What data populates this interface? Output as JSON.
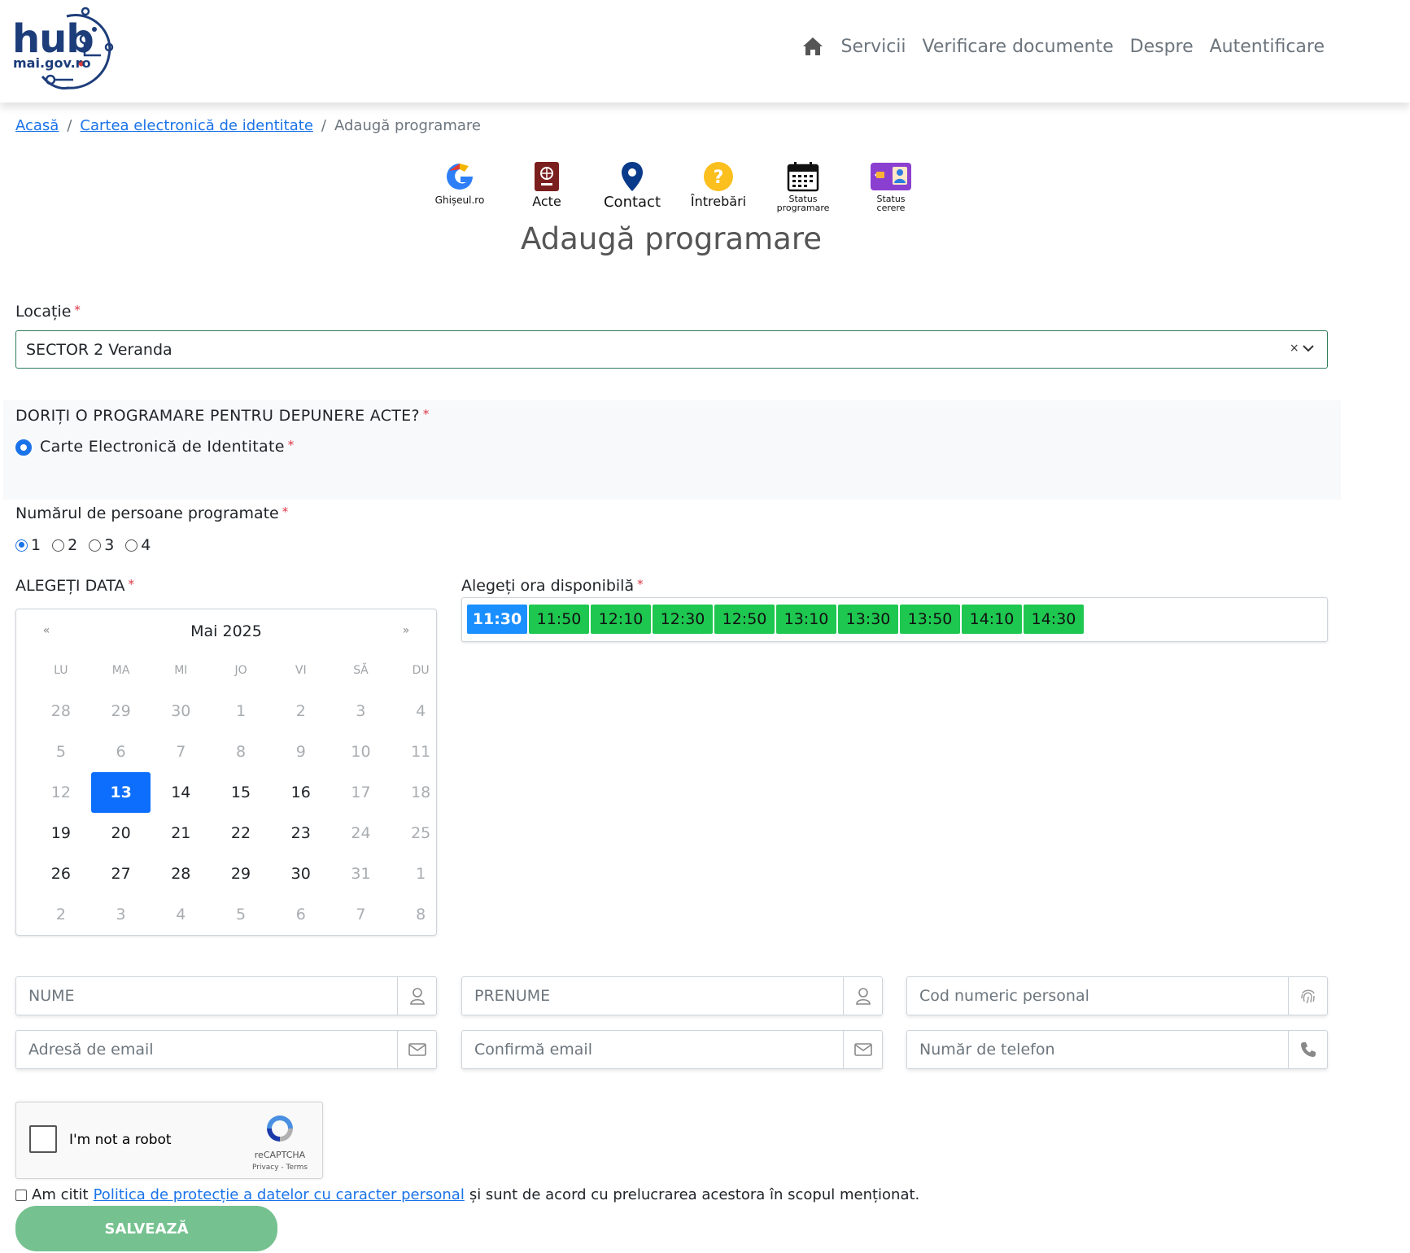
{
  "header": {
    "logo_main": "hub",
    "logo_sub": "mai.gov.ro",
    "nav": [
      "Servicii",
      "Verificare documente",
      "Despre",
      "Autentificare"
    ]
  },
  "breadcrumb": {
    "home": "Acasă",
    "section": "Cartea electronică de identitate",
    "current": "Adaugă programare"
  },
  "icons": [
    {
      "label": "Ghișeul.ro",
      "icon": "ghiseul-logo-icon"
    },
    {
      "label": "Acte",
      "icon": "passport-icon"
    },
    {
      "label": "Contact",
      "icon": "map-pin-icon"
    },
    {
      "label": "Întrebări",
      "icon": "question-icon"
    },
    {
      "label": "Status programare",
      "icon": "calendar-icon"
    },
    {
      "label": "Status cerere",
      "icon": "id-card-icon"
    }
  ],
  "page_title": "Adaugă programare",
  "location": {
    "label": "Locație",
    "value": "SECTOR 2 Veranda",
    "clear": "×"
  },
  "appointment_type": {
    "question": "DORIȚI O PROGRAMARE PENTRU DEPUNERE ACTE?",
    "option": "Carte Electronică de Identitate"
  },
  "persons": {
    "label": "Numărul de persoane programate",
    "options": [
      "1",
      "2",
      "3",
      "4"
    ],
    "selected": "1"
  },
  "date": {
    "label": "ALEGEȚI DATA",
    "month": "Mai 2025",
    "prev": "«",
    "next": "»",
    "weekdays": [
      "LU",
      "MA",
      "MI",
      "JO",
      "VI",
      "SĂ",
      "DU"
    ],
    "weeks": [
      [
        "28",
        "29",
        "30",
        "1",
        "2",
        "3",
        "4"
      ],
      [
        "5",
        "6",
        "7",
        "8",
        "9",
        "10",
        "11"
      ],
      [
        "12",
        "13",
        "14",
        "15",
        "16",
        "17",
        "18"
      ],
      [
        "19",
        "20",
        "21",
        "22",
        "23",
        "24",
        "25"
      ],
      [
        "26",
        "27",
        "28",
        "29",
        "30",
        "31",
        "1"
      ],
      [
        "2",
        "3",
        "4",
        "5",
        "6",
        "7",
        "8"
      ]
    ],
    "selected": "13"
  },
  "time": {
    "label": "Alegeți ora disponibilă",
    "slots": [
      "11:30",
      "11:50",
      "12:10",
      "12:30",
      "12:50",
      "13:10",
      "13:30",
      "13:50",
      "14:10",
      "14:30"
    ],
    "selected": "11:30"
  },
  "fields": {
    "nume": "NUME",
    "prenume": "PRENUME",
    "cnp": "Cod numeric personal",
    "email": "Adresă de email",
    "email_confirm": "Confirmă email",
    "phone": "Număr de telefon"
  },
  "captcha": {
    "text": "I'm not a robot",
    "brand": "reCAPTCHA",
    "links": "Privacy - Terms"
  },
  "consent": {
    "prefix": "Am citit",
    "link": "Politica de protecție a datelor cu caracter personal",
    "suffix": "și sunt de acord cu prelucrarea acestora în scopul menționat."
  },
  "save_label": "SALVEAZĂ",
  "colors": {
    "link": "#1a73e8",
    "slot_green": "#1ec750",
    "slot_selected": "#1a8fff",
    "calendar_selected": "#0d6efd",
    "save_button": "#75c18f",
    "brand_navy": "#1d3d7a"
  }
}
